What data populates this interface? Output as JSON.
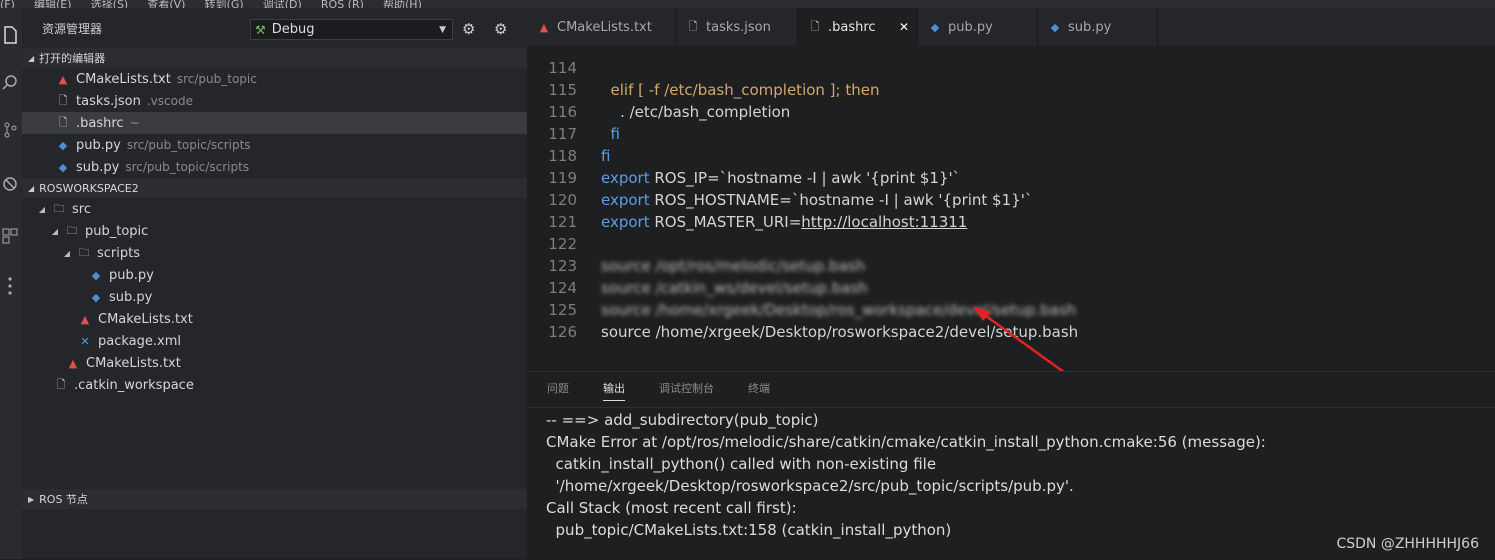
{
  "menubar": [
    "(F)",
    "编辑(E)",
    "选择(S)",
    "查看(V)",
    "转到(G)",
    "调试(D)",
    "ROS (R)",
    "帮助(H)"
  ],
  "sidebar": {
    "title": "资源管理器",
    "debug_config": "Debug",
    "open_editors": {
      "label": "打开的编辑器",
      "items": [
        {
          "name": "CMakeLists.txt",
          "desc": "src/pub_topic"
        },
        {
          "name": "tasks.json",
          "desc": ".vscode"
        },
        {
          "name": ".bashrc",
          "desc": "~"
        },
        {
          "name": "pub.py",
          "desc": "src/pub_topic/scripts"
        },
        {
          "name": "sub.py",
          "desc": "src/pub_topic/scripts"
        }
      ]
    },
    "workspace": {
      "label": "ROSWORKSPACE2",
      "tree": [
        "src",
        "pub_topic",
        "scripts",
        "pub.py",
        "sub.py",
        "CMakeLists.txt",
        "package.xml",
        "CMakeLists.txt",
        ".catkin_workspace"
      ]
    },
    "ros_nodes_label": "ROS 节点"
  },
  "tabs": [
    "CMakeLists.txt",
    "tasks.json",
    ".bashrc",
    "pub.py",
    "sub.py"
  ],
  "editor": {
    "lines": [
      {
        "n": "114",
        "text": "  elif [ -f /etc/bash_completion ]; then"
      },
      {
        "n": "115",
        "text": "    . /etc/bash_completion"
      },
      {
        "n": "116",
        "text": "  fi"
      },
      {
        "n": "117",
        "text": "fi"
      },
      {
        "n": "118",
        "kw": "export",
        "text": " ROS_IP=`hostname -I | awk '{print $1}'`"
      },
      {
        "n": "119",
        "kw": "export",
        "text": " ROS_HOSTNAME=`hostname -I | awk '{print $1}'`"
      },
      {
        "n": "120",
        "kw": "export",
        "text": " ROS_MASTER_URI=",
        "url": "http://localhost:11311"
      },
      {
        "n": "121",
        "text": ""
      },
      {
        "n": "122",
        "text": "source /opt/ros/melodic/setup.bash",
        "blur": true
      },
      {
        "n": "123",
        "text": "source /catkin_ws/devel/setup.bash",
        "blur": true
      },
      {
        "n": "124",
        "text": "source /home/xrgeek/Desktop/ros_workspace/devel/setup.bash",
        "blur": true
      },
      {
        "n": "125",
        "text": "source /home/xrgeek/Desktop/rosworkspace2/devel/setup.bash"
      },
      {
        "n": "126",
        "text": ""
      }
    ]
  },
  "panel": {
    "tabs": [
      "问题",
      "输出",
      "调试控制台",
      "终端"
    ],
    "active_tab": "输出",
    "output_lines": [
      "-- ==> add_subdirectory(pub_topic)",
      "CMake Error at /opt/ros/melodic/share/catkin/cmake/catkin_install_python.cmake:56 (message):",
      "  catkin_install_python() called with non-existing file",
      "  '/home/xrgeek/Desktop/rosworkspace2/src/pub_topic/scripts/pub.py'.",
      "Call Stack (most recent call first):",
      "  pub_topic/CMakeLists.txt:158 (catkin_install_python)"
    ]
  },
  "watermark": "CSDN @ZHHHHHJ66",
  "colors": {
    "keyword": "#5c9ee8",
    "error_arrow": "#e02424",
    "background": "#1e1f21"
  }
}
